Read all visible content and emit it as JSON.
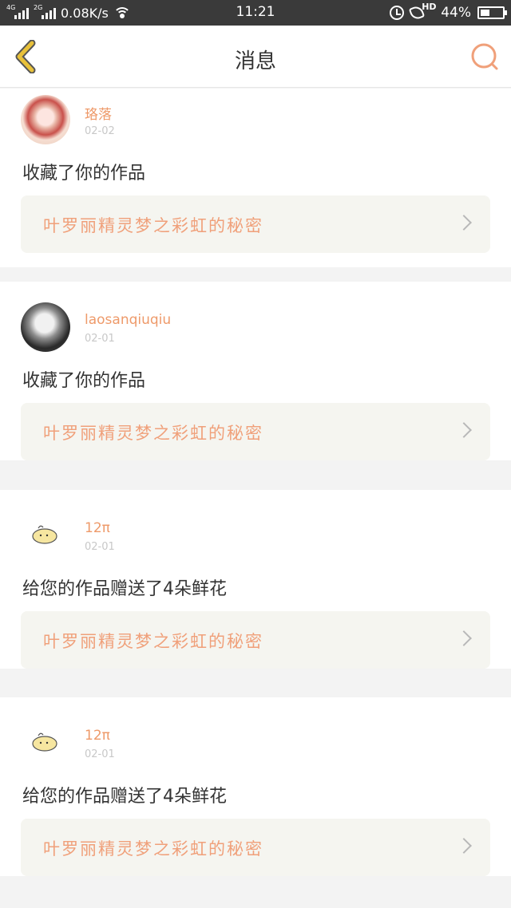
{
  "status_bar": {
    "net1": "4G",
    "net2": "2G",
    "speed": "0.08K/s",
    "time": "11:21",
    "hd": "HD",
    "battery": "44%",
    "battery_level": 0.44
  },
  "header": {
    "title": "消息",
    "back_icon": "chevron-left-icon",
    "search_icon": "search-icon",
    "accent_back": "#e8c13a",
    "accent_search": "#f0a07a"
  },
  "messages": [
    {
      "username": "珞落",
      "date": "02-02",
      "action": "收藏了你的作品",
      "work_title": "叶罗丽精灵梦之彩虹的秘密"
    },
    {
      "username": "laosanqiuqiu",
      "date": "02-01",
      "action": "收藏了你的作品",
      "work_title": "叶罗丽精灵梦之彩虹的秘密"
    },
    {
      "username": "12π",
      "date": "02-01",
      "action": "给您的作品赠送了4朵鲜花",
      "work_title": "叶罗丽精灵梦之彩虹的秘密"
    },
    {
      "username": "12π",
      "date": "02-01",
      "action": "给您的作品赠送了4朵鲜花",
      "work_title": "叶罗丽精灵梦之彩虹的秘密"
    }
  ]
}
